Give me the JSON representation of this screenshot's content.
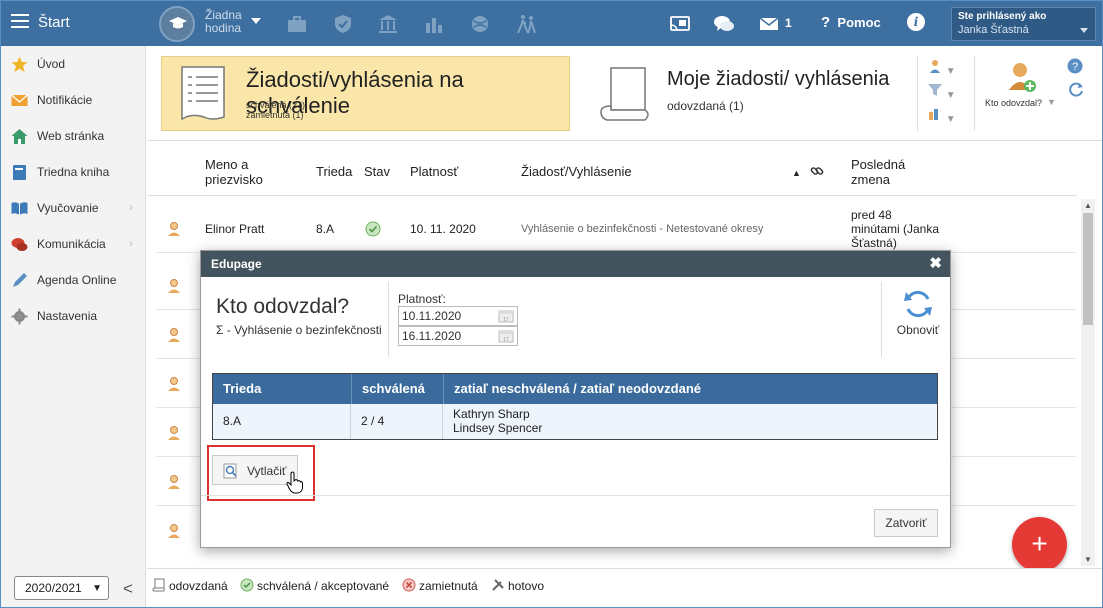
{
  "topbar": {
    "menu_label": "Štart",
    "no_hour_line1": "Žiadna",
    "no_hour_line2": "hodina",
    "mail_count": "1",
    "help_label": "Pomoc",
    "info_glyph": "i",
    "user_heading": "Ste prihlásený ako",
    "user_name": "Janka Šťastná"
  },
  "sidebar": {
    "items": [
      {
        "label": "Úvod",
        "icon": "star-icon",
        "color": "#f0b429"
      },
      {
        "label": "Notifikácie",
        "icon": "envelope-icon",
        "color": "#f0a030"
      },
      {
        "label": "Web stránka",
        "icon": "house-icon",
        "color": "#3a9a6a"
      },
      {
        "label": "Triedna kniha",
        "icon": "book-icon",
        "color": "#3d7ab8"
      },
      {
        "label": "Vyučovanie",
        "icon": "open-book-icon",
        "color": "#3d7ab8"
      },
      {
        "label": "Komunikácia",
        "icon": "chat-icon",
        "color": "#d04030"
      },
      {
        "label": "Agenda Online",
        "icon": "pen-icon",
        "color": "#5a8fc4"
      },
      {
        "label": "Nastavenia",
        "icon": "gear-icon",
        "color": "#888888"
      }
    ],
    "year": "2020/2021",
    "collapse_glyph": "<"
  },
  "cards": {
    "approval_title": "Žiadosti/vyhlásenia na schválenie",
    "approval_sub1": "schválená (21)",
    "approval_sub2": "zamietnutá (1)",
    "mine_title": "Moje žiadosti/ vyhlásenia",
    "mine_sub": "odovzdaná (1)",
    "who_label": "Kto odovzdal?"
  },
  "table": {
    "headers": {
      "name": "Meno a priezvisko",
      "name_l1": "Meno a",
      "name_l2": "priezvisko",
      "class": "Trieda",
      "state": "Stav",
      "validity": "Platnosť",
      "request": "Žiadosť/Vyhlásenie",
      "last_l1": "Posledná",
      "last_l2": "zmena"
    },
    "rows": [
      {
        "name": "Elinor Pratt",
        "class": "8.A",
        "validity": "10. 11. 2020",
        "request": "Vyhlásenie o bezinfekčnosti - Netestované okresy",
        "last_l1": "pred 48",
        "last_l2": "minútami (Janka",
        "last_l3": "Šťastná)"
      }
    ]
  },
  "modal": {
    "header": "Edupage",
    "close_glyph": "✖",
    "title": "Kto odovzdal?",
    "subtitle": "Σ - Vyhlásenie o bezinfekčnosti",
    "validity_label": "Platnosť:",
    "date_from": "10.11.2020",
    "date_to": "16.11.2020",
    "refresh_label": "Obnoviť",
    "columns": [
      "Trieda",
      "schválená",
      "zatiaľ neschválená / zatiaľ neodovzdané"
    ],
    "rows": [
      {
        "class": "8.A",
        "approved": "2 / 4",
        "pending_1": "Kathryn Sharp",
        "pending_2": "Lindsey Spencer"
      }
    ],
    "print_label": "Vytlačiť",
    "close_label": "Zatvoriť"
  },
  "legend": {
    "submitted": "odovzdaná",
    "approved": "schválená / akceptované",
    "rejected": "zamietnutá",
    "done": "hotovo"
  },
  "colors": {
    "topbar": "#3d6fa0",
    "accent_yellow": "#f9e6a8",
    "modal_header": "#44545f",
    "table_header": "#3b6b9c",
    "fab": "#e53935",
    "highlight": "#d93030"
  }
}
